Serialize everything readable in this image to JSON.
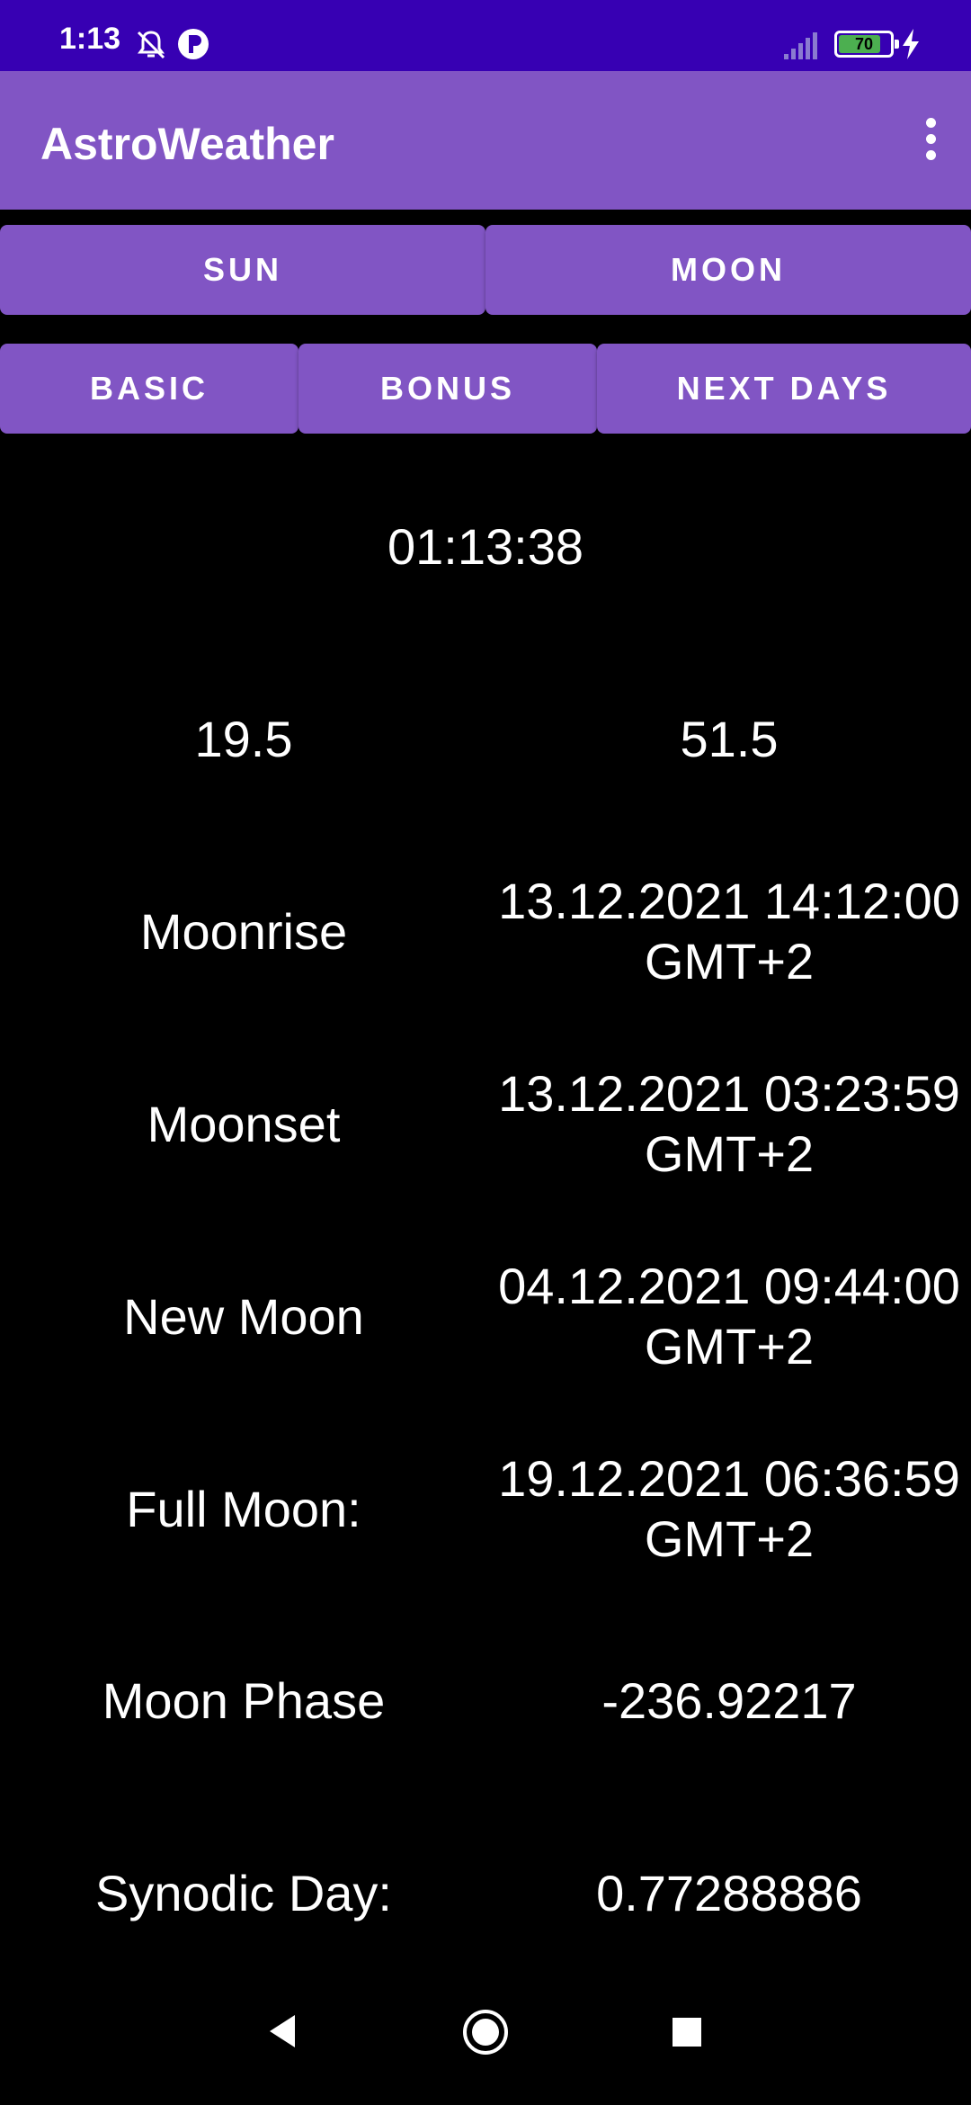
{
  "status_bar": {
    "time": "1:13",
    "battery": "70",
    "background_color": "#3700b3"
  },
  "app_bar": {
    "title": "AstroWeather",
    "background_color": "#8155c4",
    "menu_icon": "overflow-menu-icon"
  },
  "tabs_top": [
    {
      "label": "SUN"
    },
    {
      "label": "MOON"
    }
  ],
  "tabs_bottom": [
    {
      "label": "BASIC"
    },
    {
      "label": "BONUS"
    },
    {
      "label": "NEXT DAYS"
    }
  ],
  "clock": "01:13:38",
  "coordinates": {
    "longitude": "19.5",
    "latitude": "51.5"
  },
  "rows": [
    {
      "label": "Moonrise",
      "value_line1": "13.12.2021 14:12:00",
      "value_line2": "GMT+2"
    },
    {
      "label": "Moonset",
      "value_line1": "13.12.2021 03:23:59",
      "value_line2": "GMT+2"
    },
    {
      "label": "New Moon",
      "value_line1": "04.12.2021 09:44:00",
      "value_line2": "GMT+2"
    },
    {
      "label": "Full Moon:",
      "value_line1": "19.12.2021 06:36:59",
      "value_line2": "GMT+2"
    },
    {
      "label": "Moon Phase",
      "value_line1": "-236.92217"
    },
    {
      "label": "Synodic Day:",
      "value_line1": "0.77288886"
    }
  ],
  "nav_bar": {
    "back_icon": "back-triangle-icon",
    "home_icon": "home-circle-icon",
    "recents_icon": "recents-square-icon"
  }
}
